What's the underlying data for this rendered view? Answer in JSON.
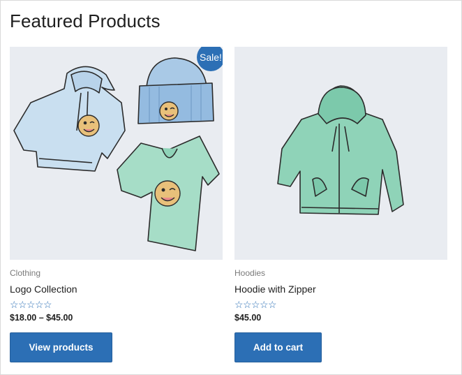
{
  "section": {
    "title": "Featured Products"
  },
  "products": [
    {
      "image_icon": "clothing-collection-illustration",
      "badge": "Sale!",
      "category": "Clothing",
      "name": "Logo Collection",
      "rating_icon": "star-outline-icon",
      "rating": 0,
      "rating_max": 5,
      "price": "$18.00 – $45.00",
      "button_label": "View products"
    },
    {
      "image_icon": "hoodie-illustration",
      "category": "Hoodies",
      "name": "Hoodie with Zipper",
      "rating_icon": "star-outline-icon",
      "rating": 0,
      "rating_max": 5,
      "price": "$45.00",
      "button_label": "Add to cart"
    }
  ],
  "colors": {
    "accent": "#2c6fb5",
    "image_bg": "#e9ecf1",
    "hoodie_blue": "#c9dff0",
    "beanie_blue": "#94bbe0",
    "teal": "#8fd3b8",
    "face": "#e8c07a"
  }
}
